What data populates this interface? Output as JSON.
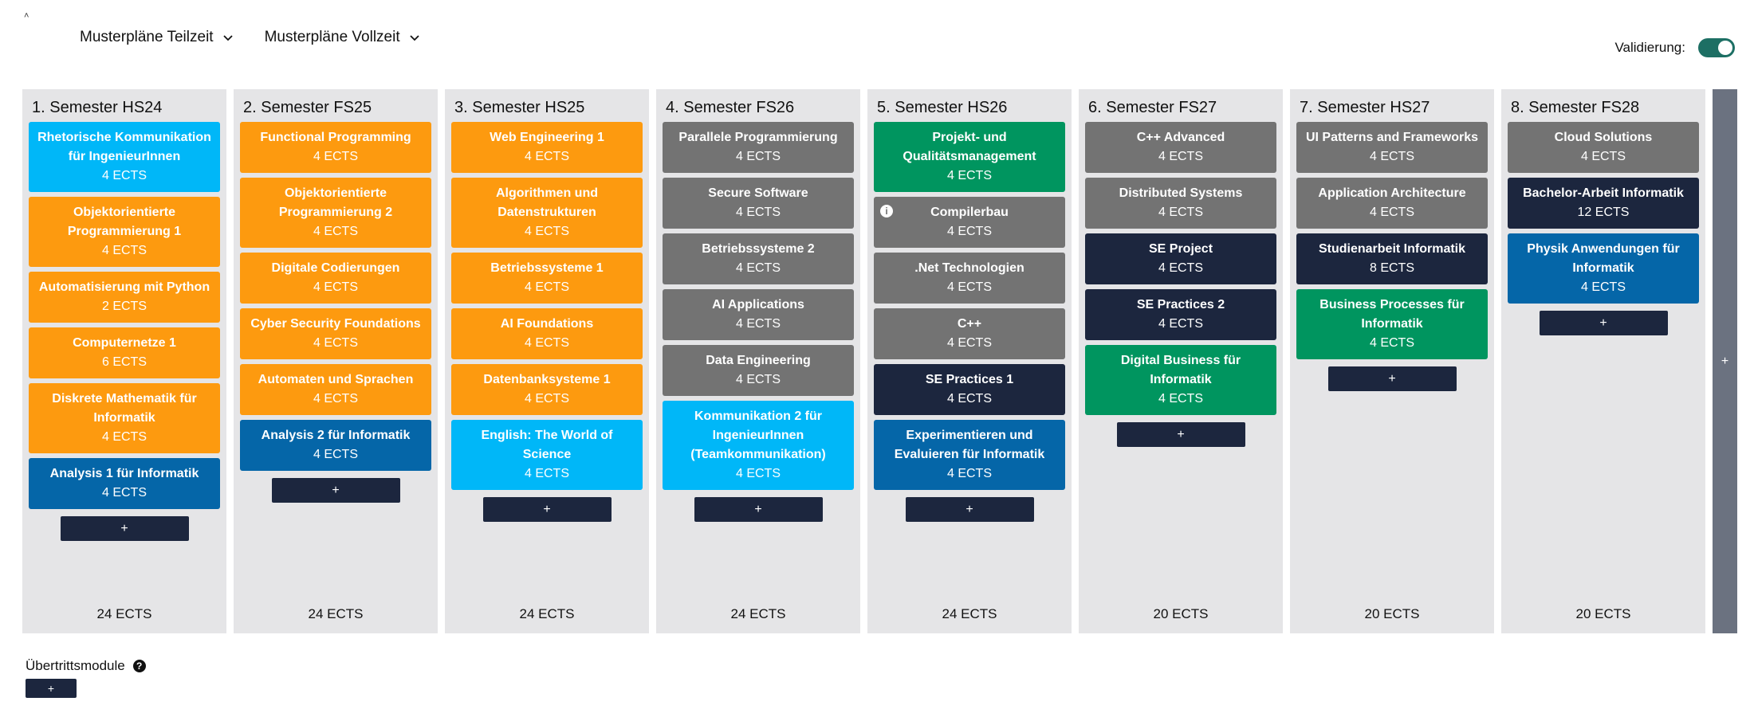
{
  "header": {
    "tiny_mark": "˄",
    "nav": [
      {
        "label": "Musterpläne Teilzeit"
      },
      {
        "label": "Musterpläne Vollzeit"
      }
    ],
    "validation_label": "Validierung:",
    "validation_on": true
  },
  "add_label": "+",
  "semesters": [
    {
      "title": "1. Semester HS24",
      "total": "24 ECTS",
      "modules": [
        {
          "name": "Rhetorische Kommunikation für IngenieurInnen",
          "ects": "4 ECTS",
          "color": "#00b7f8"
        },
        {
          "name": "Objektorientierte Programmierung 1",
          "ects": "4 ECTS",
          "color": "#fd9a0f"
        },
        {
          "name": "Automatisierung mit Python",
          "ects": "2 ECTS",
          "color": "#fd9a0f"
        },
        {
          "name": "Computernetze 1",
          "ects": "6 ECTS",
          "color": "#fd9a0f"
        },
        {
          "name": "Diskrete Mathematik für Informatik",
          "ects": "4 ECTS",
          "color": "#fd9a0f"
        },
        {
          "name": "Analysis 1 für Informatik",
          "ects": "4 ECTS",
          "color": "#0566a8"
        }
      ]
    },
    {
      "title": "2. Semester FS25",
      "total": "24 ECTS",
      "modules": [
        {
          "name": "Functional Programming",
          "ects": "4 ECTS",
          "color": "#fd9a0f"
        },
        {
          "name": "Objektorientierte Programmierung 2",
          "ects": "4 ECTS",
          "color": "#fd9a0f"
        },
        {
          "name": "Digitale Codierungen",
          "ects": "4 ECTS",
          "color": "#fd9a0f"
        },
        {
          "name": "Cyber Security Foundations",
          "ects": "4 ECTS",
          "color": "#fd9a0f"
        },
        {
          "name": "Automaten und Sprachen",
          "ects": "4 ECTS",
          "color": "#fd9a0f"
        },
        {
          "name": "Analysis 2 für Informatik",
          "ects": "4 ECTS",
          "color": "#0566a8"
        }
      ]
    },
    {
      "title": "3. Semester HS25",
      "total": "24 ECTS",
      "modules": [
        {
          "name": "Web Engineering 1",
          "ects": "4 ECTS",
          "color": "#fd9a0f"
        },
        {
          "name": "Algorithmen und Datenstrukturen",
          "ects": "4 ECTS",
          "color": "#fd9a0f"
        },
        {
          "name": "Betriebssysteme 1",
          "ects": "4 ECTS",
          "color": "#fd9a0f"
        },
        {
          "name": "AI Foundations",
          "ects": "4 ECTS",
          "color": "#fd9a0f"
        },
        {
          "name": "Datenbanksysteme 1",
          "ects": "4 ECTS",
          "color": "#fd9a0f"
        },
        {
          "name": "English: The World of Science",
          "ects": "4 ECTS",
          "color": "#00b7f8"
        }
      ]
    },
    {
      "title": "4. Semester FS26",
      "total": "24 ECTS",
      "modules": [
        {
          "name": "Parallele Programmierung",
          "ects": "4 ECTS",
          "color": "#737373"
        },
        {
          "name": "Secure Software",
          "ects": "4 ECTS",
          "color": "#737373"
        },
        {
          "name": "Betriebssysteme 2",
          "ects": "4 ECTS",
          "color": "#737373"
        },
        {
          "name": "AI Applications",
          "ects": "4 ECTS",
          "color": "#737373"
        },
        {
          "name": "Data Engineering",
          "ects": "4 ECTS",
          "color": "#737373"
        },
        {
          "name": "Kommunikation 2 für IngenieurInnen (Teamkommunikation)",
          "ects": "4 ECTS",
          "color": "#00b7f8"
        }
      ]
    },
    {
      "title": "5. Semester HS26",
      "total": "24 ECTS",
      "modules": [
        {
          "name": "Projekt- und Qualitätsmanagement",
          "ects": "4 ECTS",
          "color": "#00955f"
        },
        {
          "name": "Compilerbau",
          "ects": "4 ECTS",
          "color": "#737373",
          "info": true
        },
        {
          "name": ".Net Technologien",
          "ects": "4 ECTS",
          "color": "#737373"
        },
        {
          "name": "C++",
          "ects": "4 ECTS",
          "color": "#737373"
        },
        {
          "name": "SE Practices 1",
          "ects": "4 ECTS",
          "color": "#1c263e"
        },
        {
          "name": "Experimentieren und Evaluieren für Informatik",
          "ects": "4 ECTS",
          "color": "#0566a8"
        }
      ]
    },
    {
      "title": "6. Semester FS27",
      "total": "20 ECTS",
      "modules": [
        {
          "name": "C++ Advanced",
          "ects": "4 ECTS",
          "color": "#737373"
        },
        {
          "name": "Distributed Systems",
          "ects": "4 ECTS",
          "color": "#737373"
        },
        {
          "name": "SE Project",
          "ects": "4 ECTS",
          "color": "#1c263e"
        },
        {
          "name": "SE Practices 2",
          "ects": "4 ECTS",
          "color": "#1c263e"
        },
        {
          "name": "Digital Business für Informatik",
          "ects": "4 ECTS",
          "color": "#00955f"
        }
      ]
    },
    {
      "title": "7. Semester HS27",
      "total": "20 ECTS",
      "modules": [
        {
          "name": "UI Patterns and Frameworks",
          "ects": "4 ECTS",
          "color": "#737373"
        },
        {
          "name": "Application Architecture",
          "ects": "4 ECTS",
          "color": "#737373"
        },
        {
          "name": "Studienarbeit Informatik",
          "ects": "8 ECTS",
          "color": "#1c263e"
        },
        {
          "name": "Business Processes für Informatik",
          "ects": "4 ECTS",
          "color": "#00955f"
        }
      ]
    },
    {
      "title": "8. Semester FS28",
      "total": "20 ECTS",
      "modules": [
        {
          "name": "Cloud Solutions",
          "ects": "4 ECTS",
          "color": "#737373"
        },
        {
          "name": "Bachelor-Arbeit Informatik",
          "ects": "12 ECTS",
          "color": "#1c263e"
        },
        {
          "name": "Physik Anwendungen für Informatik",
          "ects": "4 ECTS",
          "color": "#0566a8"
        }
      ]
    }
  ],
  "transfer": {
    "label": "Übertrittsmodule",
    "help_icon": "?",
    "info_icon": "i"
  }
}
